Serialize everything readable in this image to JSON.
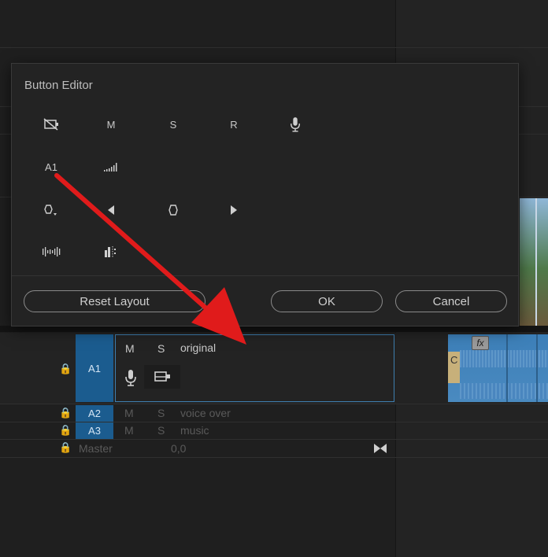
{
  "dialog": {
    "title": "Button Editor",
    "icons_row1": {
      "sync_lock": "sync-lock-icon",
      "mute": "M",
      "solo": "S",
      "record": "R",
      "mic": "microphone-icon"
    },
    "icons_row2": {
      "track_label": "A1",
      "volume": "meter-icon"
    },
    "icons_row3": {
      "keyframe_menu": "keyframe-menu-icon",
      "prev": "previous-keyframe-icon",
      "add": "add-keyframe-icon",
      "next": "next-keyframe-icon"
    },
    "icons_row4": {
      "waveform": "waveform-icon",
      "meters": "meters-icon"
    },
    "reset_label": "Reset Layout",
    "ok_label": "OK",
    "cancel_label": "Cancel"
  },
  "tracks": {
    "a1": {
      "tag": "A1",
      "mute": "M",
      "solo": "S",
      "name": "original"
    },
    "a2": {
      "tag": "A2",
      "mute": "M",
      "solo": "S",
      "name": "voice over"
    },
    "a3": {
      "tag": "A3",
      "mute": "M",
      "solo": "S",
      "name": "music"
    },
    "master": {
      "name": "Master",
      "value": "0,0"
    }
  },
  "clip": {
    "fx_badge": "fx",
    "clip_letter": "C"
  },
  "colors": {
    "accent": "#1b5c8f",
    "arrow": "#e01b1b",
    "clip": "#4a86bf"
  }
}
